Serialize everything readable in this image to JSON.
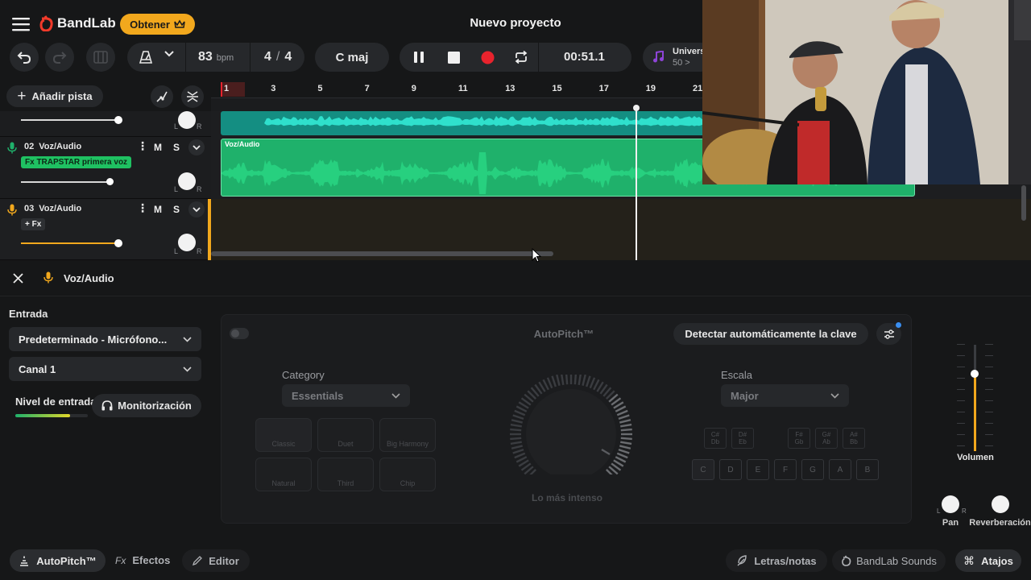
{
  "app": {
    "brand": "BandLab",
    "get_label": "Obtener",
    "project_title": "Nuevo proyecto"
  },
  "transport": {
    "bpm": "83",
    "bpm_unit": "bpm",
    "time_sig_num": "4",
    "time_sig_sep": "/",
    "time_sig_den": "4",
    "key": "C maj",
    "time": "00:51.1",
    "universe_label": "Univers",
    "universe_sub": "50 >"
  },
  "colors": {
    "accent": "#f2a81d",
    "record": "#e8232d",
    "track1": "#19b8a6",
    "track2": "#1fb16b",
    "playhead": "#f0f0f0"
  },
  "tracks_header": {
    "add_track": "Añadir pista"
  },
  "ruler": {
    "bars": [
      "1",
      "3",
      "5",
      "7",
      "9",
      "11",
      "13",
      "15",
      "17",
      "19",
      "21"
    ]
  },
  "tracks": [
    {
      "name": "",
      "pan_l": "L",
      "pan_r": "R"
    },
    {
      "number": "02",
      "name": "Voz/Audio",
      "fx": "Fx TRAPSTAR primera voz",
      "mute": "M",
      "solo": "S",
      "pan_l": "L",
      "pan_r": "R",
      "region_label": "Voz/Audio"
    },
    {
      "number": "03",
      "name": "Voz/Audio",
      "fx": "+ Fx",
      "mute": "M",
      "solo": "S",
      "pan_l": "L",
      "pan_r": "R"
    }
  ],
  "panel": {
    "track_name": "Voz/Audio",
    "input_label": "Entrada",
    "input_device": "Predeterminado - Micrófono...",
    "channel": "Canal 1",
    "level_label": "Nivel de entrada",
    "monitor_label": "Monitorización",
    "autopitch_title": "AutoPitch™",
    "detect_key": "Detectar automáticamente la clave",
    "category_label": "Category",
    "category_value": "Essentials",
    "presets": [
      "Classic",
      "Duet",
      "Big Harmony",
      "Natural",
      "Third",
      "Chip"
    ],
    "intensity_label": "Lo más intenso",
    "scale_label": "Escala",
    "scale_value": "Major",
    "sharps": [
      "C#\nDb",
      "D#\nEb",
      "F#\nGb",
      "G#\nAb",
      "A#\nBb"
    ],
    "notes": [
      "C",
      "D",
      "E",
      "F",
      "G",
      "A",
      "B"
    ],
    "volume_label": "Volumen",
    "pan_label": "Pan",
    "pan_l": "L",
    "pan_r": "R",
    "reverb_label": "Reverberación"
  },
  "bottom_tabs": {
    "autopitch": "AutoPitch™",
    "effects_prefix": "Fx",
    "effects": "Efectos",
    "editor": "Editor",
    "lyrics": "Letras/notas",
    "sounds": "BandLab Sounds",
    "shortcuts": "Atajos"
  }
}
